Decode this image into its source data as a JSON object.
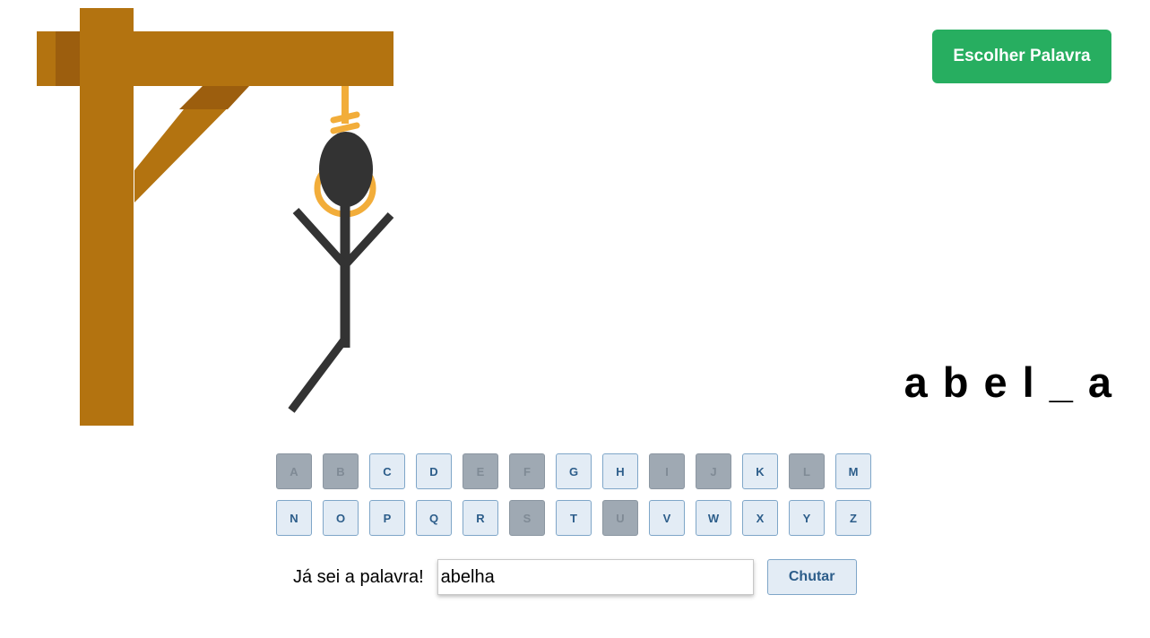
{
  "header": {
    "choose_word_label": "Escolher Palavra"
  },
  "word": {
    "letters": [
      "a",
      "b",
      "e",
      "l",
      "_",
      "a"
    ]
  },
  "keyboard": {
    "rows": [
      [
        {
          "letter": "A",
          "used": true
        },
        {
          "letter": "B",
          "used": true
        },
        {
          "letter": "C",
          "used": false
        },
        {
          "letter": "D",
          "used": false
        },
        {
          "letter": "E",
          "used": true
        },
        {
          "letter": "F",
          "used": true
        },
        {
          "letter": "G",
          "used": false
        },
        {
          "letter": "H",
          "used": false
        },
        {
          "letter": "I",
          "used": true
        },
        {
          "letter": "J",
          "used": true
        },
        {
          "letter": "K",
          "used": false
        },
        {
          "letter": "L",
          "used": true
        },
        {
          "letter": "M",
          "used": false
        }
      ],
      [
        {
          "letter": "N",
          "used": false
        },
        {
          "letter": "O",
          "used": false
        },
        {
          "letter": "P",
          "used": false
        },
        {
          "letter": "Q",
          "used": false
        },
        {
          "letter": "R",
          "used": false
        },
        {
          "letter": "S",
          "used": true
        },
        {
          "letter": "T",
          "used": false
        },
        {
          "letter": "U",
          "used": true
        },
        {
          "letter": "V",
          "used": false
        },
        {
          "letter": "W",
          "used": false
        },
        {
          "letter": "X",
          "used": false
        },
        {
          "letter": "Y",
          "used": false
        },
        {
          "letter": "Z",
          "used": false
        }
      ]
    ]
  },
  "guess": {
    "label": "Já sei a palavra!",
    "value": "abelha",
    "button_label": "Chutar"
  },
  "hangman": {
    "errors": 5,
    "parts_drawn": [
      "head",
      "body",
      "left-arm",
      "right-arm",
      "left-leg"
    ]
  },
  "colors": {
    "accent": "#27ae60",
    "wood": "#b37310",
    "wood_dark": "#9c5e0e",
    "rope": "#f2ad3a",
    "figure": "#333333",
    "key_bg": "#e3ecf5",
    "key_used_bg": "#9fa9b3",
    "key_text": "#2c5d8a"
  }
}
